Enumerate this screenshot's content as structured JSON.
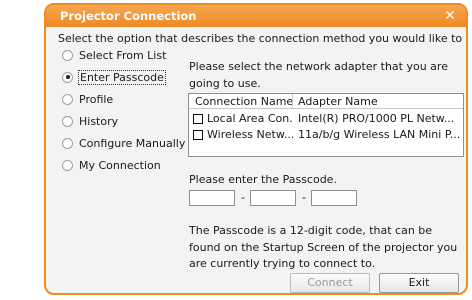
{
  "window": {
    "title": "Projector Connection",
    "close_glyph": "✕",
    "accent_color": "#f08c1e"
  },
  "instruction": "Select the option that describes the connection method you would like to use:",
  "options": [
    {
      "label": "Select From List",
      "checked": false
    },
    {
      "label": "Enter Passcode",
      "checked": true
    },
    {
      "label": "Profile",
      "checked": false
    },
    {
      "label": "History",
      "checked": false
    },
    {
      "label": "Configure Manually",
      "checked": false
    },
    {
      "label": "My Connection",
      "checked": false
    }
  ],
  "adapter_prompt": "Please select the network adapter that you are going to use.",
  "adapter_list": {
    "columns": [
      "Connection Name",
      "Adapter Name"
    ],
    "rows": [
      {
        "checked": false,
        "connection": "Local Area Con...",
        "adapter": "Intel(R) PRO/1000 PL Netw..."
      },
      {
        "checked": false,
        "connection": "Wireless Netw...",
        "adapter": "11a/b/g Wireless LAN Mini P..."
      }
    ]
  },
  "passcode_prompt": "Please enter the Passcode.",
  "passcode_fields": [
    "",
    "",
    ""
  ],
  "passcode_separator": "-",
  "info_text": "The Passcode is a 12-digit code, that can be found on the Startup Screen of the projector you are currently trying to connect to.",
  "buttons": {
    "connect": "Connect",
    "exit": "Exit"
  }
}
